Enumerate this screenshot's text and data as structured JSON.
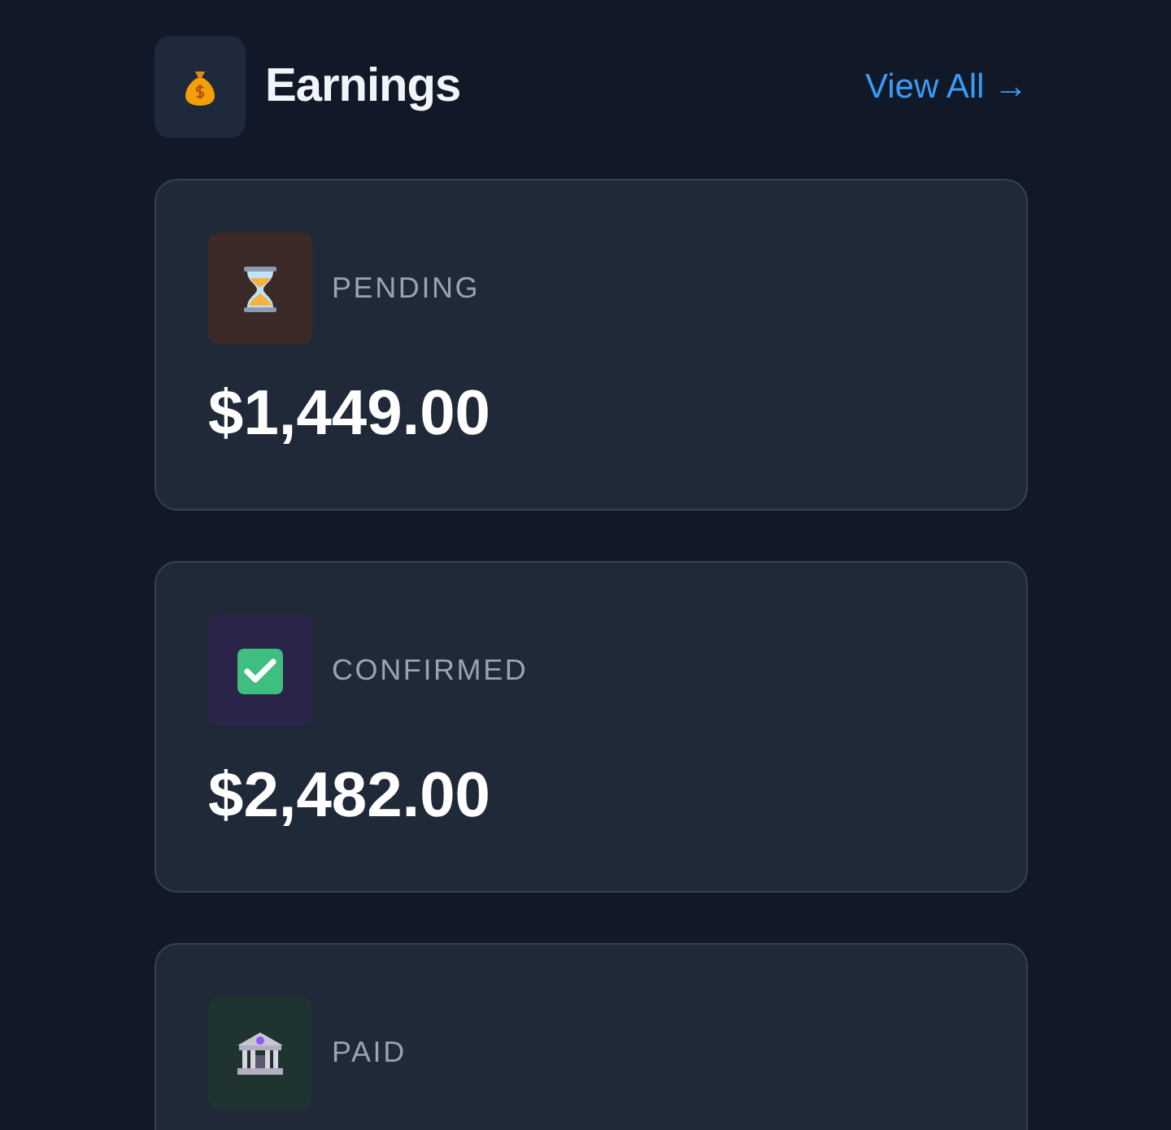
{
  "header": {
    "title": "Earnings",
    "link": "View All →"
  },
  "cards": [
    {
      "kind": "pending",
      "label": "PENDING",
      "amount": "$1,449.00"
    },
    {
      "kind": "confirmed",
      "label": "CONFIRMED",
      "amount": "$2,482.00"
    },
    {
      "kind": "paid",
      "label": "PAID"
    }
  ]
}
